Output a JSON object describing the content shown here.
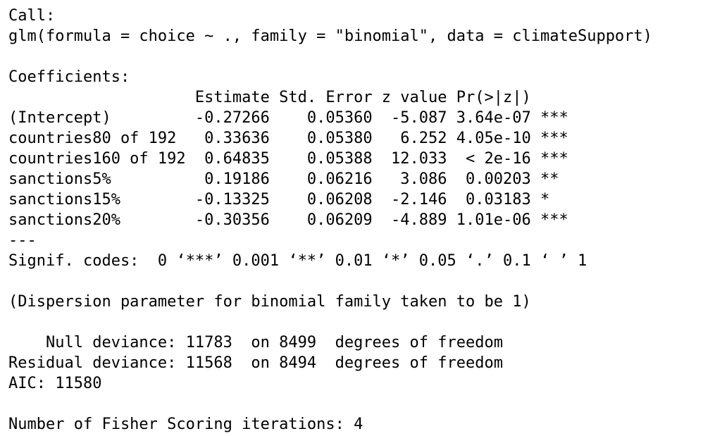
{
  "console": {
    "call_header": "Call:",
    "call": "glm(formula = choice ~ ., family = \"binomial\", data = climateSupport)",
    "coef_header": "Coefficients:",
    "table_header": "                    Estimate Std. Error z value Pr(>|z|)    ",
    "rows": [
      "(Intercept)         -0.27266    0.05360  -5.087 3.64e-07 ***",
      "countries80 of 192   0.33636    0.05380   6.252 4.05e-10 ***",
      "countries160 of 192  0.64835    0.05388  12.033  < 2e-16 ***",
      "sanctions5%          0.19186    0.06216   3.086  0.00203 ** ",
      "sanctions15%        -0.13325    0.06208  -2.146  0.03183 *  ",
      "sanctions20%        -0.30356    0.06209  -4.889 1.01e-06 ***"
    ],
    "separator": "---",
    "signif_codes": "Signif. codes:  0 ‘***’ 0.001 ‘**’ 0.01 ‘*’ 0.05 ‘.’ 0.1 ‘ ’ 1",
    "dispersion": "(Dispersion parameter for binomial family taken to be 1)",
    "null_deviance": "    Null deviance: 11783  on 8499  degrees of freedom",
    "residual_deviance": "Residual deviance: 11568  on 8494  degrees of freedom",
    "aic": "AIC: 11580",
    "fisher": "Number of Fisher Scoring iterations: 4"
  }
}
